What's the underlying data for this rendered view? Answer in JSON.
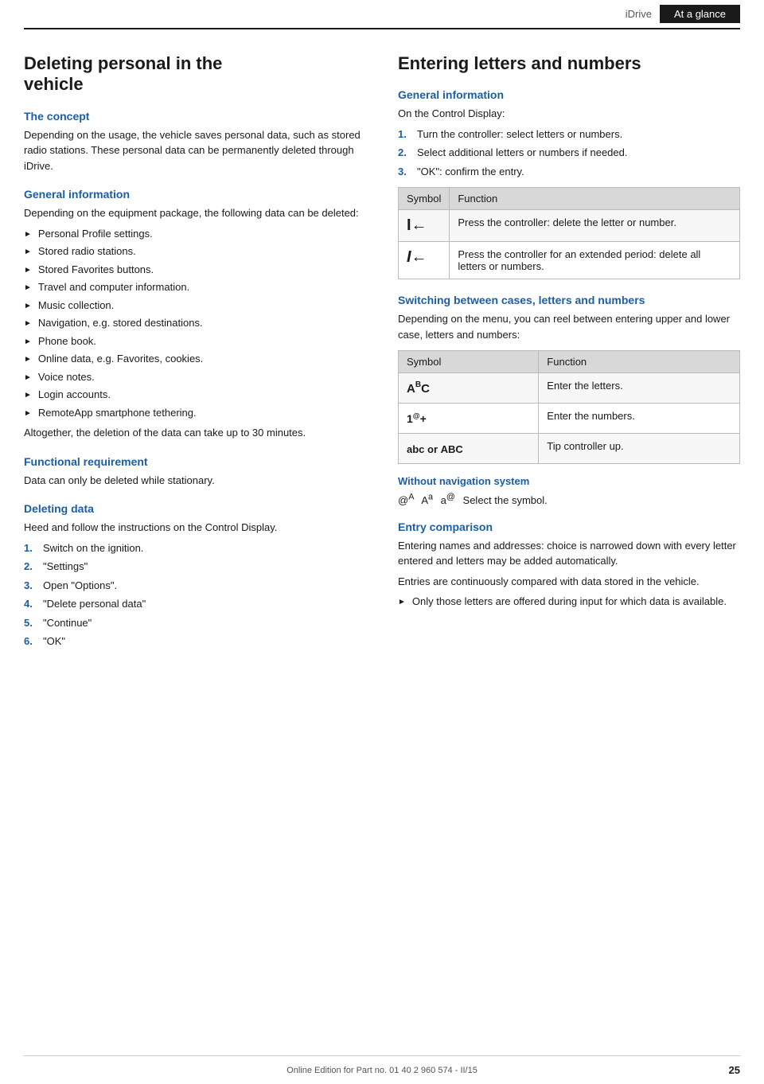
{
  "header": {
    "idrive_label": "iDrive",
    "tab_label": "At a glance"
  },
  "left": {
    "page_title_line1": "Deleting personal in the",
    "page_title_line2": "vehicle",
    "concept_heading": "The concept",
    "concept_text": "Depending on the usage, the vehicle saves personal data, such as stored radio stations. These personal data can be permanently deleted through iDrive.",
    "general_info_heading": "General information",
    "general_info_text": "Depending on the equipment package, the following data can be deleted:",
    "bullet_items": [
      "Personal Profile settings.",
      "Stored radio stations.",
      "Stored Favorites buttons.",
      "Travel and computer information.",
      "Music collection.",
      "Navigation, e.g. stored destinations.",
      "Phone book.",
      "Online data, e.g. Favorites, cookies.",
      "Voice notes.",
      "Login accounts.",
      "RemoteApp smartphone tethering."
    ],
    "general_info_footer": "Altogether, the deletion of the data can take up to 30 minutes.",
    "functional_heading": "Functional requirement",
    "functional_text": "Data can only be deleted while stationary.",
    "deleting_heading": "Deleting data",
    "deleting_text": "Heed and follow the instructions on the Control Display.",
    "steps": [
      {
        "num": "1.",
        "text": "Switch on the ignition."
      },
      {
        "num": "2.",
        "text": "\"Settings\""
      },
      {
        "num": "3.",
        "text": "Open \"Options\"."
      },
      {
        "num": "4.",
        "text": "\"Delete personal data\""
      },
      {
        "num": "5.",
        "text": "\"Continue\""
      },
      {
        "num": "6.",
        "text": "\"OK\""
      }
    ]
  },
  "right": {
    "page_title": "Entering letters and numbers",
    "general_info_heading": "General information",
    "general_info_intro": "On the Control Display:",
    "right_steps": [
      {
        "num": "1.",
        "text": "Turn the controller: select letters or numbers."
      },
      {
        "num": "2.",
        "text": "Select additional letters or numbers if needed."
      },
      {
        "num": "3.",
        "text": "\"OK\": confirm the entry."
      }
    ],
    "table1": {
      "col1": "Symbol",
      "col2": "Function",
      "rows": [
        {
          "symbol": "I←",
          "function": "Press the controller: delete the letter or number."
        },
        {
          "symbol": "I←",
          "function": "Press the controller for an extended period: delete all letters or numbers."
        }
      ]
    },
    "switching_heading": "Switching between cases, letters and numbers",
    "switching_text": "Depending on the menu, you can reel between entering upper and lower case, letters and numbers:",
    "table2": {
      "col1": "Symbol",
      "col2": "Function",
      "rows": [
        {
          "symbol": "Aᴬc",
          "function": "Enter the letters."
        },
        {
          "symbol": "1@+",
          "function": "Enter the numbers."
        },
        {
          "symbol": "abc or ABC",
          "function": "Tip controller up."
        }
      ]
    },
    "without_nav_heading": "Without navigation system",
    "without_nav_text": "Select the symbol.",
    "without_nav_symbols": "@ᴬ   Aᵃ   a®",
    "entry_comparison_heading": "Entry comparison",
    "entry_comparison_text1": "Entering names and addresses: choice is narrowed down with every letter entered and letters may be added automatically.",
    "entry_comparison_text2": "Entries are continuously compared with data stored in the vehicle.",
    "entry_bullet": "Only those letters are offered during input for which data is available."
  },
  "footer": {
    "text": "Online Edition for Part no. 01 40 2 960 574 - II/15",
    "page_num": "25"
  }
}
